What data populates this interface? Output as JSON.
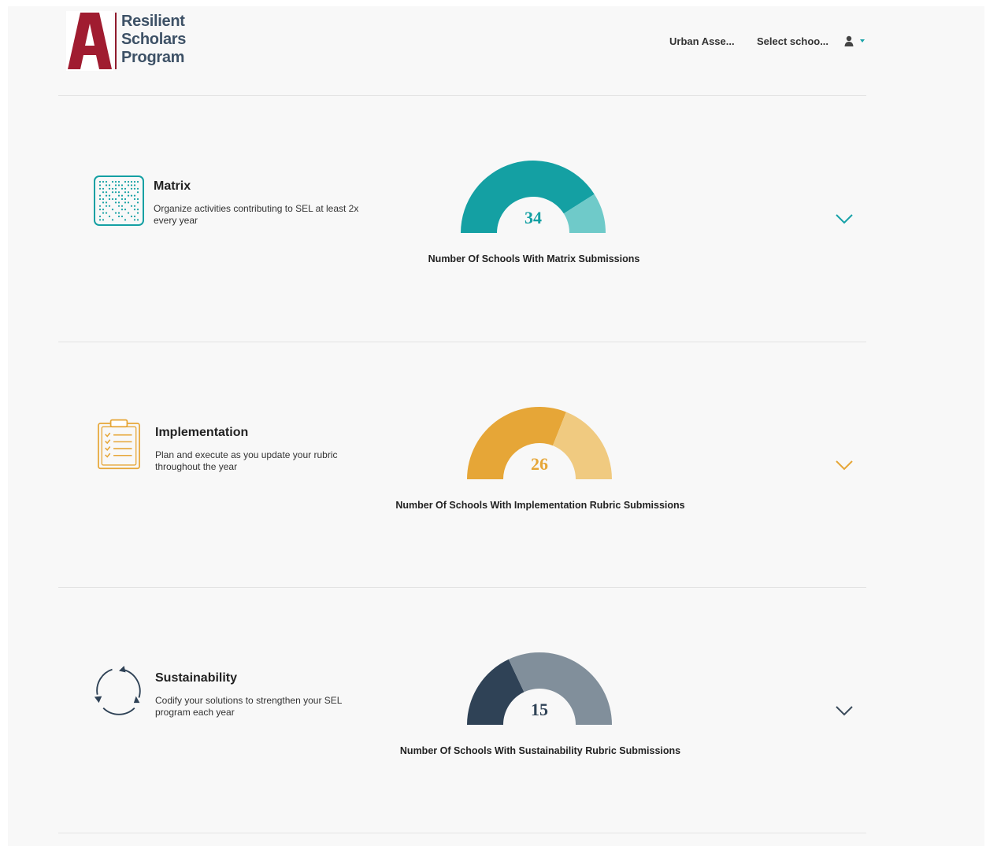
{
  "header": {
    "logo": {
      "letter": "A",
      "lines": [
        "Resilient",
        "Scholars",
        "Program"
      ]
    },
    "org_selector": "Urban Asse...",
    "school_selector": "Select schoo...",
    "user_icon": "user-icon"
  },
  "sections": [
    {
      "title": "Matrix",
      "description": "Organize activities contributing to SEL at least 2x every year",
      "icon": "matrix-grid-icon",
      "gauge_value": "34",
      "gauge_fraction": 0.82,
      "gauge_caption": "Number Of Schools With Matrix Submissions",
      "colors": {
        "primary": "#14a0a3",
        "secondary": "#6fcac9",
        "value": "#14a0a3",
        "chevron": "#17a2a8"
      }
    },
    {
      "title": "Implementation",
      "description": "Plan and execute as you update your rubric throughout the year",
      "icon": "clipboard-checklist-icon",
      "gauge_value": "26",
      "gauge_fraction": 0.62,
      "gauge_caption": "Number Of Schools With Implementation Rubric Submissions",
      "colors": {
        "primary": "#e6a637",
        "secondary": "#f0ca80",
        "value": "#e6a637",
        "chevron": "#e6a637"
      }
    },
    {
      "title": "Sustainability",
      "description": "Codify your solutions to strengthen your SEL program each year",
      "icon": "cycle-arrows-icon",
      "gauge_value": "15",
      "gauge_fraction": 0.36,
      "gauge_caption": "Number Of Schools With Sustainability Rubric Submissions",
      "colors": {
        "primary": "#2f4256",
        "secondary": "#818f9b",
        "value": "#2f4256",
        "chevron": "#3a4a5a"
      }
    }
  ]
}
